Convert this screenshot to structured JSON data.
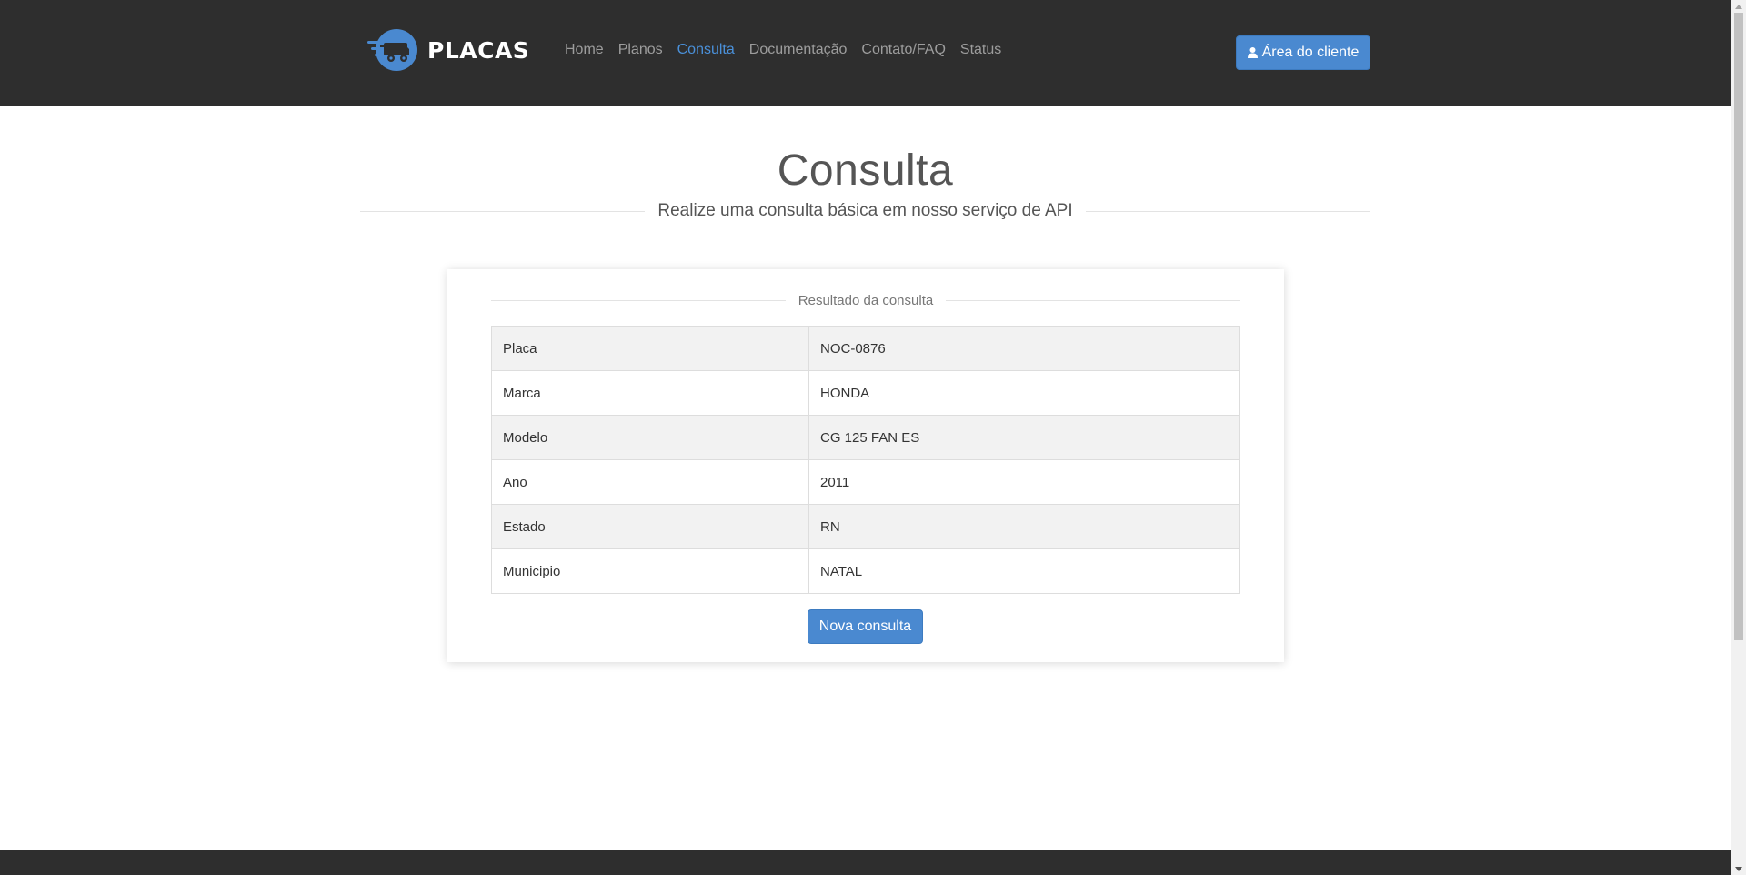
{
  "brand": {
    "name": "PLACAS",
    "accent": "#4a89d0",
    "header_bg": "#2e2e2e"
  },
  "nav": {
    "items": [
      {
        "label": "Home"
      },
      {
        "label": "Planos"
      },
      {
        "label": "Consulta",
        "active": true
      },
      {
        "label": "Documentação"
      },
      {
        "label": "Contato/FAQ"
      },
      {
        "label": "Status"
      }
    ],
    "client_button": {
      "label": "Área do cliente",
      "icon": "user-icon"
    }
  },
  "page": {
    "title": "Consulta",
    "subtitle": "Realize uma consulta básica em nosso serviço de API"
  },
  "result": {
    "legend": "Resultado da consulta",
    "rows": [
      {
        "label": "Placa",
        "value": "NOC-0876"
      },
      {
        "label": "Marca",
        "value": "HONDA"
      },
      {
        "label": "Modelo",
        "value": "CG 125 FAN ES"
      },
      {
        "label": "Ano",
        "value": "2011"
      },
      {
        "label": "Estado",
        "value": "RN"
      },
      {
        "label": "Municipio",
        "value": "NATAL"
      }
    ],
    "new_button": {
      "label": "Nova consulta"
    }
  }
}
